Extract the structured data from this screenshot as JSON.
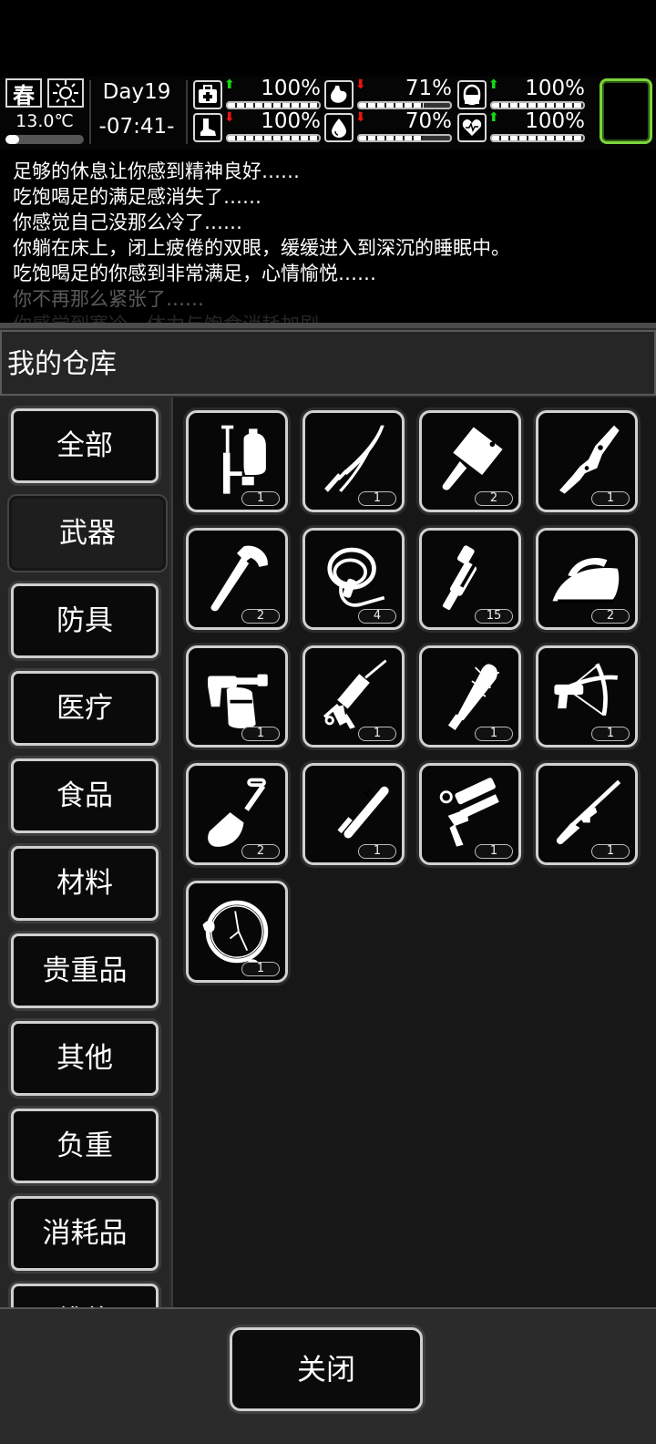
{
  "status": {
    "season": "春",
    "weather_icon": "sun-icon",
    "temperature": "13.0℃",
    "temperature_level": 0.18,
    "day": "Day19",
    "time": "-07:41-",
    "stats": [
      {
        "name": "health",
        "icon": "medkit-icon",
        "trend": "up",
        "value": "100%",
        "level": 1.0
      },
      {
        "name": "hunger",
        "icon": "stomach-icon",
        "trend": "down",
        "value": "71%",
        "level": 0.71
      },
      {
        "name": "medicine",
        "icon": "pill-icon",
        "trend": "up",
        "value": "100%",
        "level": 1.0
      },
      {
        "name": "stamina",
        "icon": "boot-icon",
        "trend": "down",
        "value": "100%",
        "level": 1.0
      },
      {
        "name": "thirst",
        "icon": "water-drop-icon",
        "trend": "down",
        "value": "70%",
        "level": 0.7
      },
      {
        "name": "mood",
        "icon": "heart-icon",
        "trend": "up",
        "value": "100%",
        "level": 1.0
      }
    ],
    "accent_color": "#7bd53a"
  },
  "log": [
    {
      "text": "足够的休息让你感到精神良好……",
      "opacity": 1
    },
    {
      "text": "吃饱喝足的满足感消失了……",
      "opacity": 1
    },
    {
      "text": "你感觉自己没那么冷了……",
      "opacity": 1
    },
    {
      "text": "你躺在床上，闭上疲倦的双眼，缓缓进入到深沉的睡眠中。",
      "opacity": 1
    },
    {
      "text": "吃饱喝足的你感到非常满足，心情愉悦……",
      "opacity": 1
    },
    {
      "text": "你不再那么紧张了……",
      "opacity": 0.35
    },
    {
      "text": "你感觉到寒冷，体力与饱食消耗加剧……",
      "opacity": 0.15
    }
  ],
  "warehouse": {
    "title": "我的仓库",
    "categories": [
      "全部",
      "武器",
      "防具",
      "医疗",
      "食品",
      "材料",
      "贵重品",
      "其他",
      "负重",
      "消耗品",
      "维修"
    ],
    "active_category": 1,
    "items": [
      {
        "icon": "sprayer-icon",
        "count": "1"
      },
      {
        "icon": "katana-icon",
        "count": "1"
      },
      {
        "icon": "cleaver-icon",
        "count": "2"
      },
      {
        "icon": "branch-club-icon",
        "count": "1"
      },
      {
        "icon": "axe-icon",
        "count": "2"
      },
      {
        "icon": "whip-icon",
        "count": "4"
      },
      {
        "icon": "pipe-wrench-icon",
        "count": "15"
      },
      {
        "icon": "iron-icon",
        "count": "2"
      },
      {
        "icon": "blowtorch-icon",
        "count": "1"
      },
      {
        "icon": "caulking-gun-icon",
        "count": "1"
      },
      {
        "icon": "spiked-bat-icon",
        "count": "1"
      },
      {
        "icon": "crossbow-icon",
        "count": "1"
      },
      {
        "icon": "shovel-icon",
        "count": "2"
      },
      {
        "icon": "baton-icon",
        "count": "1"
      },
      {
        "icon": "nail-gun-icon",
        "count": "1"
      },
      {
        "icon": "rifle-icon",
        "count": "1"
      },
      {
        "icon": "pan-lid-icon",
        "count": "1"
      }
    ]
  },
  "footer": {
    "close_label": "关闭"
  }
}
